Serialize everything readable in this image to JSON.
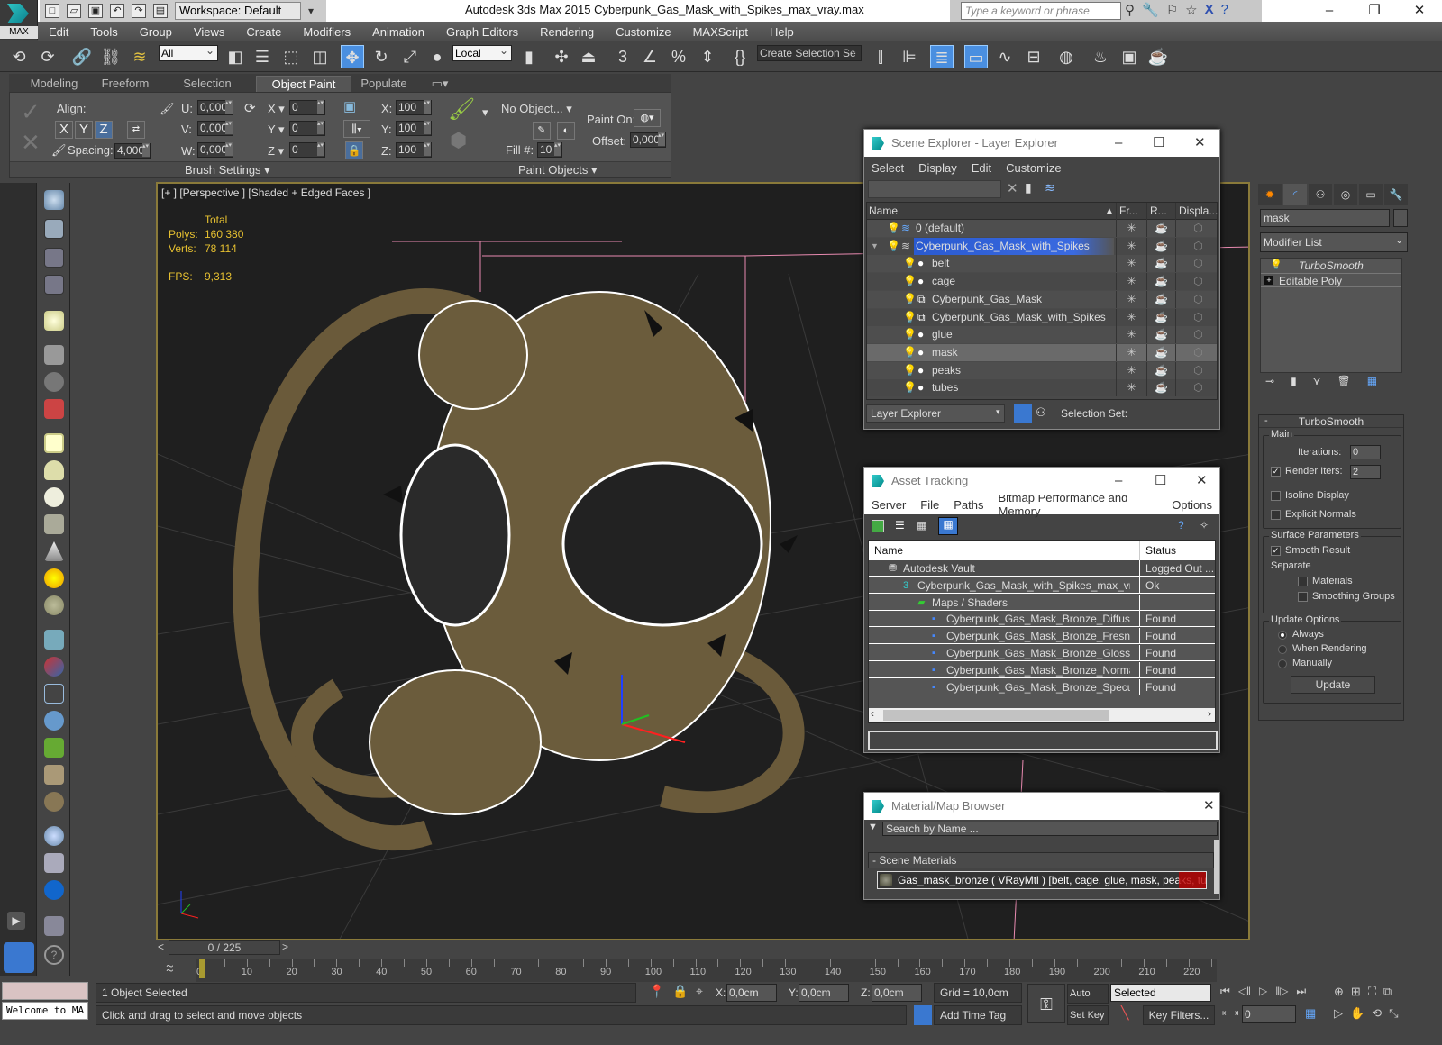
{
  "app": {
    "title": "Autodesk 3ds Max  2015    Cyberpunk_Gas_Mask_with_Spikes_max_vray.max",
    "logo_label": "MAX",
    "workspace": "Workspace: Default",
    "search_placeholder": "Type a keyword or phrase"
  },
  "menu": [
    "Edit",
    "Tools",
    "Group",
    "Views",
    "Create",
    "Modifiers",
    "Animation",
    "Graph Editors",
    "Rendering",
    "Customize",
    "MAXScript",
    "Help"
  ],
  "toolbar": {
    "selection_filter": "All",
    "ref_coord": "Local",
    "selection_set": "Create Selection Se",
    "snap_labels": [
      "3",
      "%"
    ]
  },
  "ribbon": {
    "tabs": [
      "Modeling",
      "Freeform",
      "Selection",
      "Object Paint",
      "Populate"
    ],
    "active_tab": "Object Paint",
    "align_label": "Align:",
    "axes": [
      "X",
      "Y",
      "Z"
    ],
    "spacing_label": "Spacing:",
    "spacing_value": "4,000",
    "u_label": "U:",
    "u_value": "0,000",
    "v_label": "V:",
    "v_value": "0,000",
    "w_label": "W:",
    "w_value": "0,000",
    "rx_label": "X",
    "rx_value": "0",
    "ry_label": "Y",
    "ry_value": "0",
    "rz_label": "Z",
    "rz_value": "0",
    "sx_label": "X:",
    "sx_value": "100",
    "sy_label": "Y:",
    "sy_value": "100",
    "sz_label": "Z:",
    "sz_value": "100",
    "no_object": "No Object...",
    "fill_label": "Fill #:",
    "fill_value": "10",
    "paint_on_label": "Paint On:",
    "offset_label": "Offset:",
    "offset_value": "0,000",
    "brush_settings": "Brush Settings",
    "paint_objects": "Paint Objects"
  },
  "viewport": {
    "label": "[+ ] [Perspective ] [Shaded + Edged Faces ]",
    "stats_header": "Total",
    "polys_label": "Polys:",
    "polys_value": "160 380",
    "verts_label": "Verts:",
    "verts_value": "78 114",
    "fps_label": "FPS:",
    "fps_value": "9,313"
  },
  "scene_explorer": {
    "title": "Scene Explorer - Layer Explorer",
    "menu": [
      "Select",
      "Display",
      "Edit",
      "Customize"
    ],
    "columns": [
      "Name",
      "Fr...",
      "R...",
      "Displa..."
    ],
    "rows": [
      {
        "name": "0 (default)",
        "level": 0,
        "type": "layer"
      },
      {
        "name": "Cyberpunk_Gas_Mask_with_Spikes",
        "level": 0,
        "type": "layer",
        "selected": true,
        "expanded": true
      },
      {
        "name": "belt",
        "level": 1,
        "type": "object"
      },
      {
        "name": "cage",
        "level": 1,
        "type": "object"
      },
      {
        "name": "Cyberpunk_Gas_Mask",
        "level": 1,
        "type": "group"
      },
      {
        "name": "Cyberpunk_Gas_Mask_with_Spikes",
        "level": 1,
        "type": "group"
      },
      {
        "name": "glue",
        "level": 1,
        "type": "object"
      },
      {
        "name": "mask",
        "level": 1,
        "type": "object",
        "highlighted": true
      },
      {
        "name": "peaks",
        "level": 1,
        "type": "object"
      },
      {
        "name": "tubes",
        "level": 1,
        "type": "object"
      }
    ],
    "footer_dropdown": "Layer Explorer",
    "selection_set_label": "Selection Set:"
  },
  "asset_tracking": {
    "title": "Asset Tracking",
    "menu": [
      "Server",
      "File",
      "Paths",
      "Bitmap Performance and Memory",
      "Options"
    ],
    "columns": [
      "Name",
      "Status"
    ],
    "rows": [
      {
        "name": "Autodesk Vault",
        "status": "Logged Out ...",
        "level": 1
      },
      {
        "name": "Cyberpunk_Gas_Mask_with_Spikes_max_vray...",
        "status": "Ok",
        "level": 2
      },
      {
        "name": "Maps / Shaders",
        "status": "",
        "level": 3
      },
      {
        "name": "Cyberpunk_Gas_Mask_Bronze_Diffuse....",
        "status": "Found",
        "level": 4
      },
      {
        "name": "Cyberpunk_Gas_Mask_Bronze_Fresnel....",
        "status": "Found",
        "level": 4
      },
      {
        "name": "Cyberpunk_Gas_Mask_Bronze_Glossine...",
        "status": "Found",
        "level": 4
      },
      {
        "name": "Cyberpunk_Gas_Mask_Bronze_Normal....",
        "status": "Found",
        "level": 4
      },
      {
        "name": "Cyberpunk_Gas_Mask_Bronze_Specular...",
        "status": "Found",
        "level": 4
      }
    ]
  },
  "material_browser": {
    "title": "Material/Map Browser",
    "search_placeholder": "Search by Name ...",
    "section": "- Scene Materials",
    "item": "Gas_mask_bronze  ( VRayMtl )  [belt, cage, glue, mask, peaks, tub..."
  },
  "command_panel": {
    "object_name": "mask",
    "modifier_list": "Modifier List",
    "stack": [
      "TurboSmooth",
      "Editable Poly"
    ],
    "rollout_title": "TurboSmooth",
    "main_label": "Main",
    "iterations_label": "Iterations:",
    "iterations_value": "0",
    "render_iters_label": "Render Iters:",
    "render_iters_value": "2",
    "render_iters_checked": true,
    "isoline_label": "Isoline Display",
    "isoline_checked": false,
    "explicit_normals_label": "Explicit Normals",
    "explicit_normals_checked": false,
    "surface_label": "Surface Parameters",
    "smooth_result_label": "Smooth Result",
    "smooth_result_checked": true,
    "separate_label": "Separate",
    "materials_label": "Materials",
    "smoothing_groups_label": "Smoothing Groups",
    "update_options_label": "Update Options",
    "update_radios": [
      "Always",
      "When Rendering",
      "Manually"
    ],
    "update_selected": "Always",
    "update_button": "Update"
  },
  "timeline": {
    "frame_display": "0 / 225",
    "current_frame": 0,
    "total_frames": 225,
    "tick_labels": [
      "0",
      "10",
      "20",
      "30",
      "40",
      "50",
      "60",
      "70",
      "80",
      "90",
      "100",
      "110",
      "120",
      "130",
      "140",
      "150",
      "160",
      "170",
      "180",
      "190",
      "200",
      "210",
      "220"
    ]
  },
  "status": {
    "maxscript_text": "Welcome to MA",
    "selection": "1 Object Selected",
    "prompt": "Click and drag to select and move objects",
    "x_label": "X:",
    "x_value": "0,0cm",
    "y_label": "Y:",
    "y_value": "0,0cm",
    "z_label": "Z:",
    "z_value": "0,0cm",
    "grid": "Grid = 10,0cm",
    "add_time_tag": "Add Time Tag",
    "auto_key": "Auto Key",
    "set_key": "Set Key",
    "key_mode": "Selected",
    "key_filters": "Key Filters...",
    "frame_field": "0"
  }
}
